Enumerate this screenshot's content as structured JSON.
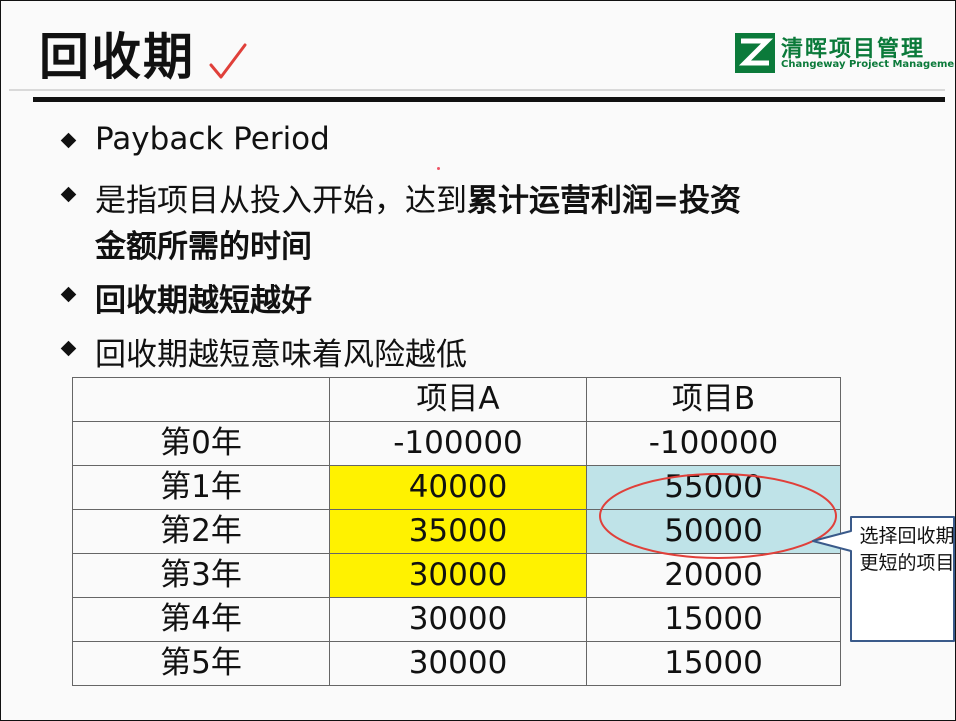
{
  "slide": {
    "title": "回收期",
    "logo": {
      "cn": "清晖项目管理",
      "en": "Changeway Project Management",
      "color": "#0b7a3a"
    },
    "bullets": {
      "b1": "Payback Period",
      "b2_normal": "是指项目从投入开始，达到",
      "b2_bold": "累计运营利润=投资",
      "b2_line2": "金额所需的时间",
      "b3": "回收期越短越好",
      "b4": "回收期越短意味着风险越低"
    },
    "table": {
      "headers": [
        "",
        "项目A",
        "项目B"
      ],
      "rows": [
        [
          "第0年",
          "-100000",
          "-100000"
        ],
        [
          "第1年",
          "40000",
          "55000"
        ],
        [
          "第2年",
          "35000",
          "50000"
        ],
        [
          "第3年",
          "30000",
          "20000"
        ],
        [
          "第4年",
          "30000",
          "15000"
        ],
        [
          "第5年",
          "30000",
          "15000"
        ]
      ],
      "highlight_a_color": "#fff200",
      "highlight_b_color": "#bfe3e8"
    },
    "callout": "选择回收期更短的项目",
    "ellipse_color": "#e0403a"
  }
}
